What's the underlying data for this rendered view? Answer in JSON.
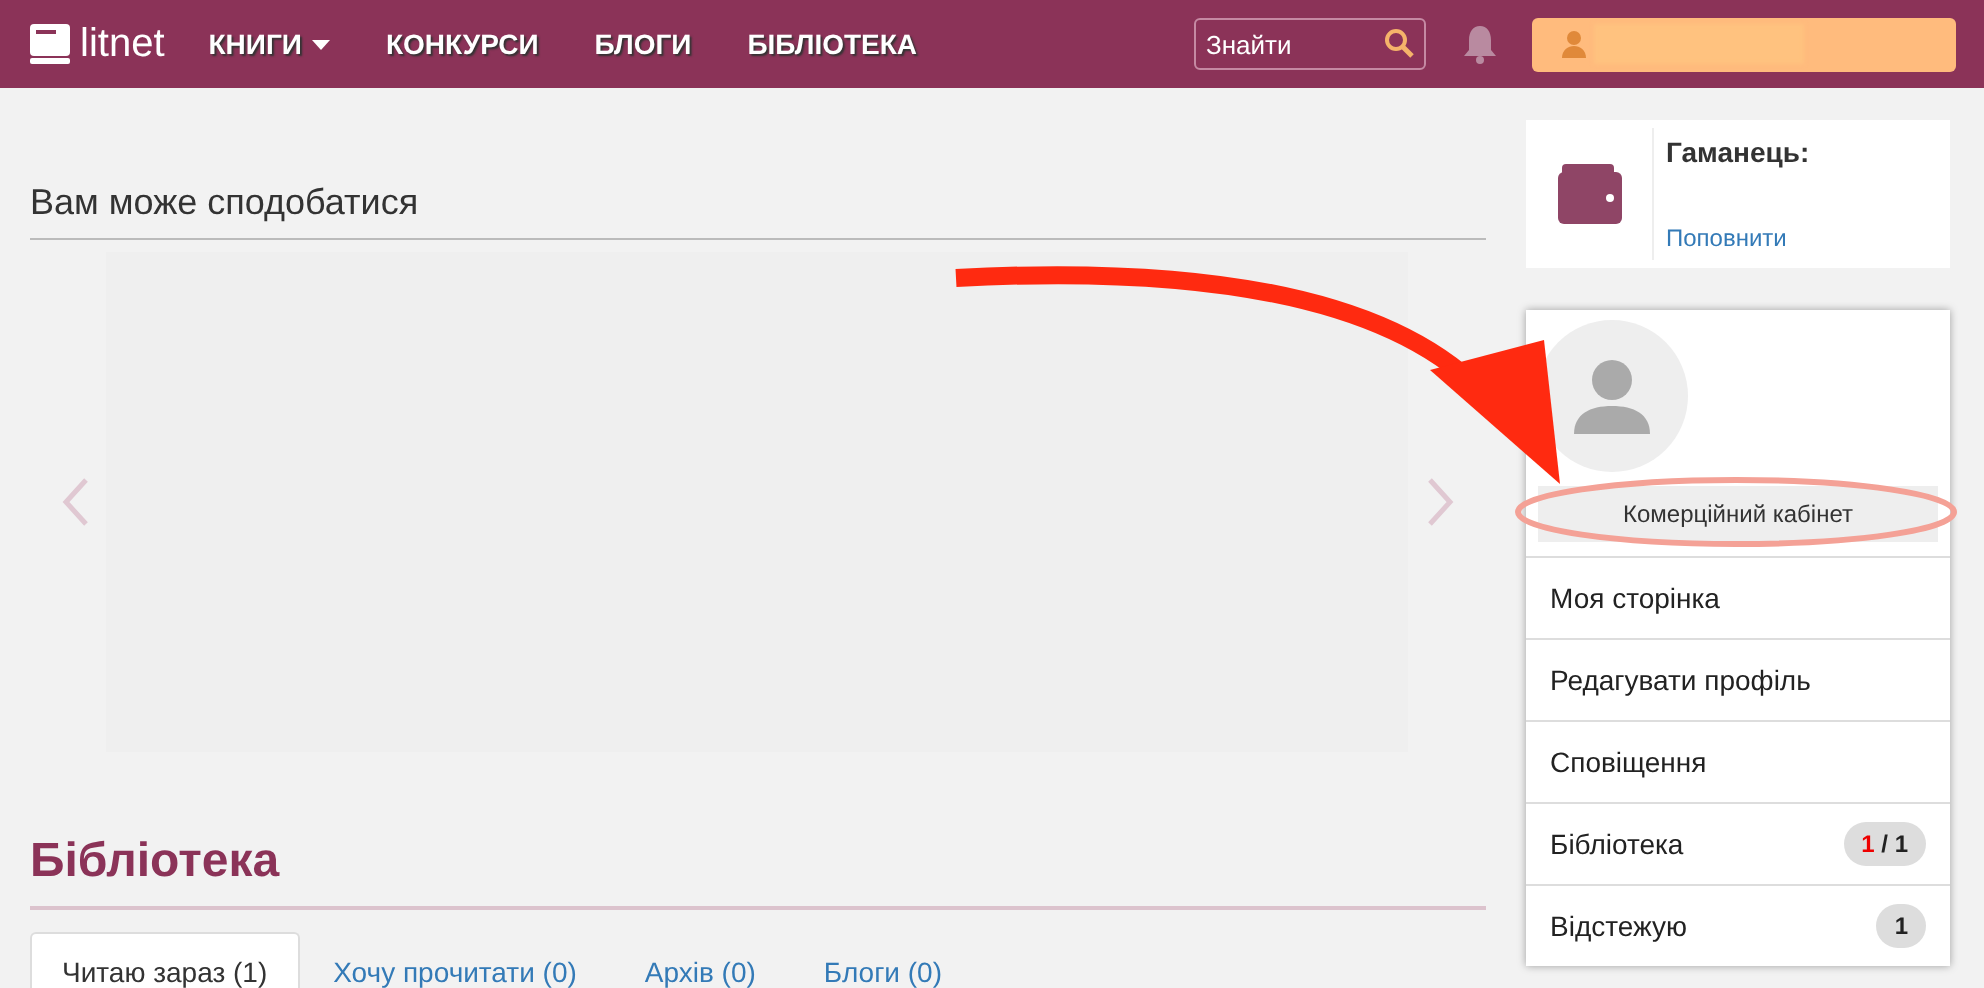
{
  "header": {
    "logo": "litnet",
    "nav": [
      {
        "label": "КНИГИ",
        "dropdown": true
      },
      {
        "label": "КОНКУРСИ",
        "dropdown": false
      },
      {
        "label": "БЛОГИ",
        "dropdown": false
      },
      {
        "label": "БІБЛІОТЕКА",
        "dropdown": false
      }
    ],
    "search": {
      "placeholder": "Знайти"
    }
  },
  "recommend": {
    "title": "Вам може сподобатися"
  },
  "library": {
    "title": "Бібліотека",
    "tabs": [
      {
        "label": "Читаю зараз (1)",
        "selected": true
      },
      {
        "label": "Хочу прочитати (0)",
        "selected": false
      },
      {
        "label": "Архів (0)",
        "selected": false
      },
      {
        "label": "Блоги (0)",
        "selected": false
      }
    ]
  },
  "wallet": {
    "title": "Гаманець:",
    "link": "Поповнити"
  },
  "profile": {
    "cabinet_button": "Комерційний кабінет",
    "menu": [
      {
        "label": "Моя сторінка"
      },
      {
        "label": "Редагувати профіль"
      },
      {
        "label": "Сповіщення"
      },
      {
        "label": "Бібліотека",
        "badge": {
          "new": "1",
          "total": "/ 1"
        }
      },
      {
        "label": "Відстежую",
        "badge": {
          "total": "1"
        }
      }
    ]
  }
}
